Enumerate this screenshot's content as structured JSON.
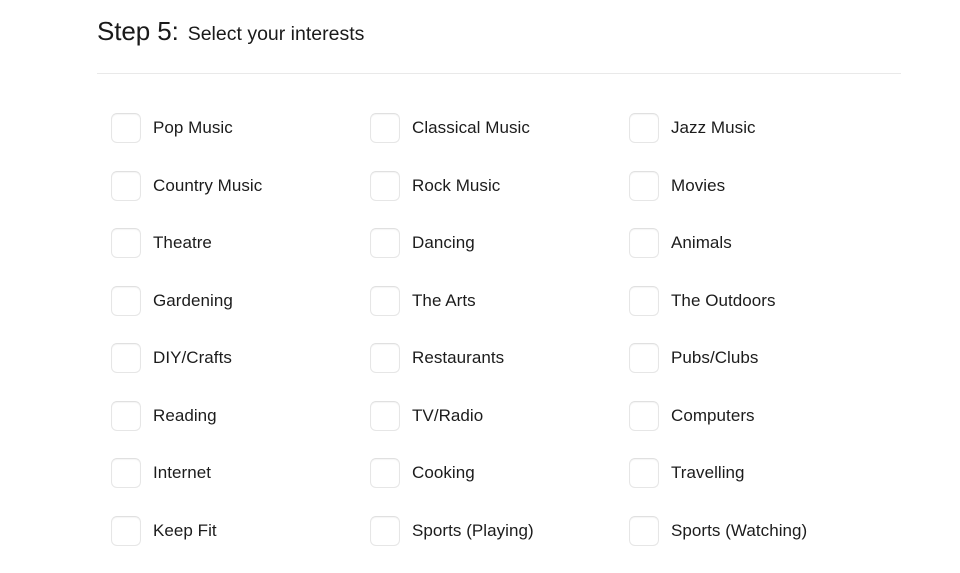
{
  "header": {
    "step_number": "Step 5:",
    "step_title": "Select your interests"
  },
  "interests": [
    {
      "label": "Pop Music",
      "checked": false
    },
    {
      "label": "Classical Music",
      "checked": false
    },
    {
      "label": "Jazz Music",
      "checked": false
    },
    {
      "label": "Country Music",
      "checked": false
    },
    {
      "label": "Rock Music",
      "checked": false
    },
    {
      "label": "Movies",
      "checked": false
    },
    {
      "label": "Theatre",
      "checked": false
    },
    {
      "label": "Dancing",
      "checked": false
    },
    {
      "label": "Animals",
      "checked": false
    },
    {
      "label": "Gardening",
      "checked": false
    },
    {
      "label": "The Arts",
      "checked": false
    },
    {
      "label": "The Outdoors",
      "checked": false
    },
    {
      "label": "DIY/Crafts",
      "checked": false
    },
    {
      "label": "Restaurants",
      "checked": false
    },
    {
      "label": "Pubs/Clubs",
      "checked": false
    },
    {
      "label": "Reading",
      "checked": false
    },
    {
      "label": "TV/Radio",
      "checked": false
    },
    {
      "label": "Computers",
      "checked": false
    },
    {
      "label": "Internet",
      "checked": false
    },
    {
      "label": "Cooking",
      "checked": false
    },
    {
      "label": "Travelling",
      "checked": false
    },
    {
      "label": "Keep Fit",
      "checked": false
    },
    {
      "label": "Sports (Playing)",
      "checked": false
    },
    {
      "label": "Sports (Watching)",
      "checked": false
    }
  ],
  "colors": {
    "page_background": "#ffffff",
    "text": "#1a1a1a",
    "divider": "#e9e9e9",
    "checkbox_border": "#e6e6e6",
    "checkbox_fill": "#ffffff"
  }
}
